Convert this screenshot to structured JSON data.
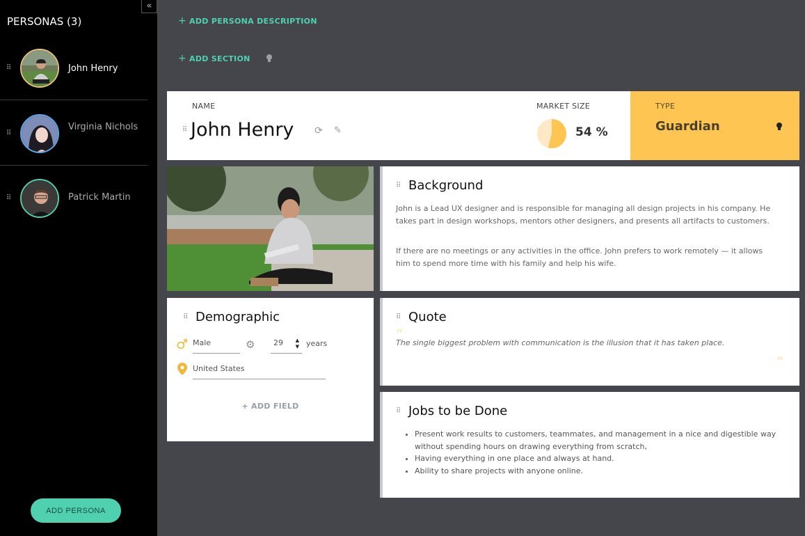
{
  "sidebar": {
    "title": "PERSONAS (3)",
    "collapse_icon": "«",
    "personas": [
      {
        "name": "John Henry"
      },
      {
        "name": "Virginia Nichols"
      },
      {
        "name": "Patrick Martin"
      }
    ],
    "add_button": "ADD PERSONA"
  },
  "top": {
    "add_description": "ADD PERSONA DESCRIPTION",
    "add_section": "ADD SECTION"
  },
  "header": {
    "name_label": "NAME",
    "name": "John Henry",
    "market_label": "MARKET SIZE",
    "market_value": "54 %",
    "market_fraction": 0.54,
    "type_label": "TYPE",
    "type_value": "Guardian"
  },
  "background": {
    "title": "Background",
    "p1": "John is a Lead UX designer and is responsible for managing all design projects in his company. He takes part in design workshops, mentors other designers, and presents all artifacts to customers.",
    "p2": "If there are no meetings or any activities in the office. John prefers to work remotely — it allows him to spend more time with his family and help his wife."
  },
  "demographic": {
    "title": "Demographic",
    "gender": "Male",
    "age": "29",
    "age_unit": "years",
    "location": "United States",
    "add_field": "+ ADD FIELD"
  },
  "quote": {
    "title": "Quote",
    "text": "The single biggest problem with communication is the illusion that it has taken place."
  },
  "jobs": {
    "title": "Jobs to be Done",
    "items": [
      "Present work results to customers, teammates, and management in a nice and digestible way without spending hours on drawing everything from scratch,",
      "Having everything in one place and always at hand.",
      "Ability to share projects with anyone online."
    ]
  },
  "colors": {
    "accent": "#4fd1b0",
    "type_bg": "#fec552",
    "page_bg": "#44464c"
  }
}
